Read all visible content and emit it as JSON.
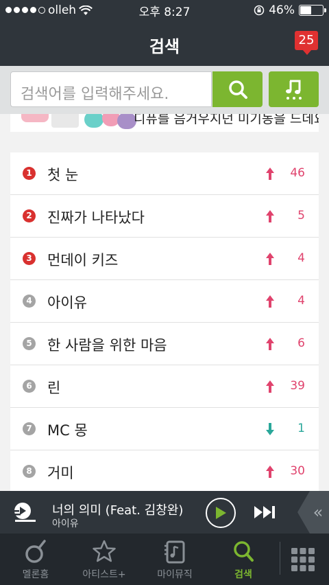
{
  "status_bar": {
    "carrier": "olleh",
    "time": "오후 8:27",
    "battery": "46%",
    "battery_level": 0.46
  },
  "header": {
    "title": "검색",
    "notification_count": "25"
  },
  "search": {
    "placeholder": "검색어를 입력해주세요."
  },
  "banner": {
    "text": "디퓨를 음거우지던 미기동을 드데요!"
  },
  "ranking": [
    {
      "rank": "1",
      "title": "첫 눈",
      "trend": "up",
      "change": "46"
    },
    {
      "rank": "2",
      "title": "진짜가 나타났다",
      "trend": "up",
      "change": "5"
    },
    {
      "rank": "3",
      "title": "먼데이 키즈",
      "trend": "up",
      "change": "4"
    },
    {
      "rank": "4",
      "title": "아이유",
      "trend": "up",
      "change": "4"
    },
    {
      "rank": "5",
      "title": "한 사람을 위한 마음",
      "trend": "up",
      "change": "6"
    },
    {
      "rank": "6",
      "title": "린",
      "trend": "up",
      "change": "39"
    },
    {
      "rank": "7",
      "title": "MC 몽",
      "trend": "down",
      "change": "1"
    },
    {
      "rank": "8",
      "title": "거미",
      "trend": "up",
      "change": "30"
    }
  ],
  "player": {
    "track": "너의 의미 (Feat. 김창완)",
    "artist": "아이유"
  },
  "tabs": [
    {
      "label": "멜론홈",
      "icon": "melon-home-icon"
    },
    {
      "label": "아티스트+",
      "icon": "star-icon"
    },
    {
      "label": "마이뮤직",
      "icon": "my-music-icon"
    },
    {
      "label": "검색",
      "icon": "search-icon",
      "active": true
    }
  ],
  "colors": {
    "accent_green": "#7cb630",
    "header_dark": "#2f353b",
    "badge_red": "#e03131",
    "rank_top": "#d9312f",
    "trend_up": "#e0436d",
    "trend_down": "#2aa79a"
  }
}
